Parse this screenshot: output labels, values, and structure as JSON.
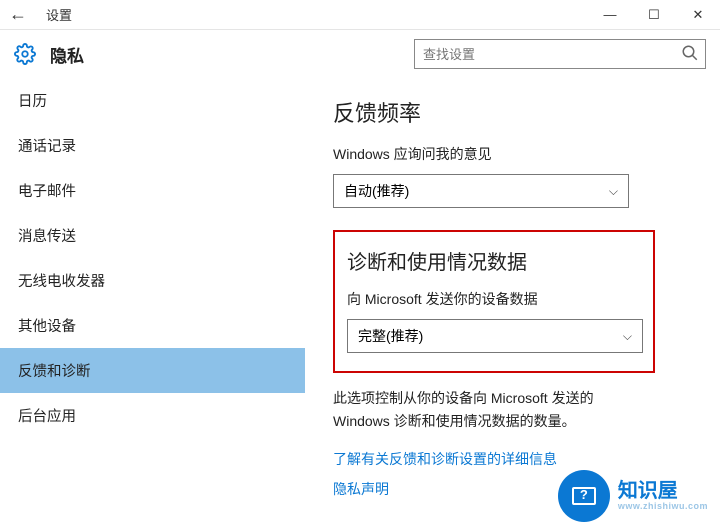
{
  "titlebar": {
    "app_title": "设置"
  },
  "header": {
    "page_title": "隐私",
    "search_placeholder": "查找设置"
  },
  "sidebar": {
    "items": [
      {
        "label": "日历"
      },
      {
        "label": "通话记录"
      },
      {
        "label": "电子邮件"
      },
      {
        "label": "消息传送"
      },
      {
        "label": "无线电收发器"
      },
      {
        "label": "其他设备"
      },
      {
        "label": "反馈和诊断"
      },
      {
        "label": "后台应用"
      }
    ],
    "selected_index": 6
  },
  "main": {
    "feedback": {
      "heading": "反馈频率",
      "label": "Windows 应询问我的意见",
      "value": "自动(推荐)"
    },
    "diagnostics": {
      "heading": "诊断和使用情况数据",
      "label": "向 Microsoft 发送你的设备数据",
      "value": "完整(推荐)",
      "description": "此选项控制从你的设备向 Microsoft 发送的 Windows 诊断和使用情况数据的数量。",
      "link1": "了解有关反馈和诊断设置的详细信息",
      "link2": "隐私声明"
    }
  },
  "watermark": {
    "name": "知识屋",
    "sub": "www.zhishiwu.com"
  }
}
